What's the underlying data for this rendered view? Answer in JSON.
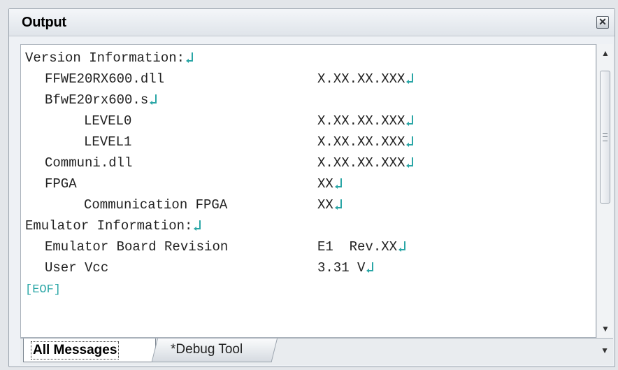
{
  "panel": {
    "title": "Output",
    "close_icon": "close-x-icon"
  },
  "output": {
    "lines": [
      {
        "left": "Version Information:",
        "left_ret": true,
        "right": "",
        "right_ret": false,
        "indent": 0
      },
      {
        "left": "FFWE20RX600.dll",
        "left_ret": false,
        "right": "X.XX.XX.XXX",
        "right_ret": true,
        "indent": 1
      },
      {
        "left": "BfwE20rx600.s",
        "left_ret": true,
        "right": "",
        "right_ret": false,
        "indent": 1
      },
      {
        "left": "LEVEL0",
        "left_ret": false,
        "right": "X.XX.XX.XXX",
        "right_ret": true,
        "indent": 2
      },
      {
        "left": "LEVEL1",
        "left_ret": false,
        "right": "X.XX.XX.XXX",
        "right_ret": true,
        "indent": 2
      },
      {
        "left": "Communi.dll",
        "left_ret": false,
        "right": "X.XX.XX.XXX",
        "right_ret": true,
        "indent": 1
      },
      {
        "left": "FPGA",
        "left_ret": false,
        "right": "XX",
        "right_ret": true,
        "indent": 1
      },
      {
        "left": "Communication FPGA",
        "left_ret": false,
        "right": "XX",
        "right_ret": true,
        "indent": 3
      },
      {
        "left": "Emulator Information:",
        "left_ret": true,
        "right": "",
        "right_ret": false,
        "indent": 0
      },
      {
        "left": "Emulator Board Revision",
        "left_ret": false,
        "right": "E1  Rev.XX",
        "right_ret": true,
        "indent": 1
      },
      {
        "left": "User Vcc",
        "left_ret": false,
        "right": "3.31 V",
        "right_ret": true,
        "indent": 1
      }
    ],
    "eof": "[EOF]"
  },
  "tabs": [
    {
      "label": "All Messages",
      "active": true
    },
    {
      "label": "*Debug Tool",
      "active": false
    }
  ],
  "colors": {
    "return_mark": "#2aa6a6",
    "eof": "#2aa6a6"
  }
}
